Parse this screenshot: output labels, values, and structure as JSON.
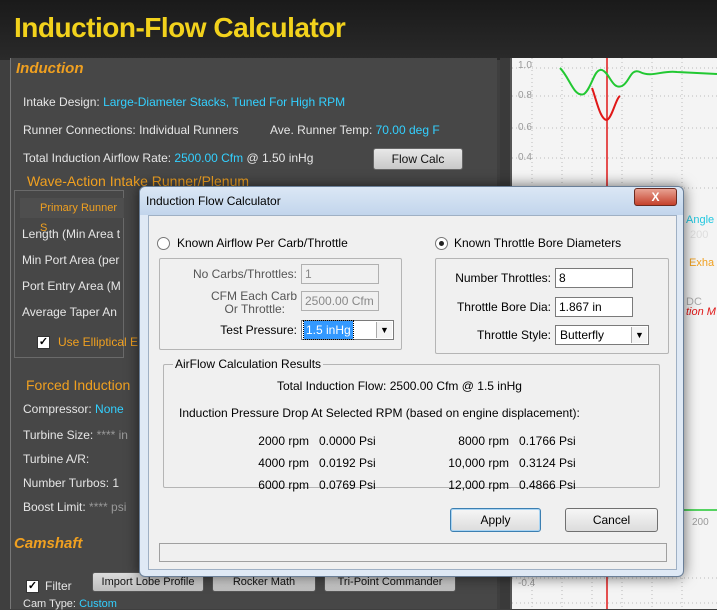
{
  "app": {
    "title": "Induction-Flow Calculator"
  },
  "background": {
    "induction_header": "Induction",
    "intake_design_label": "Intake Design:",
    "intake_design_value": "Large-Diameter Stacks, Tuned For High RPM",
    "runner_connections_label": "Runner Connections:",
    "runner_connections_value": "Individual Runners",
    "runner_temp_label": "Ave. Runner Temp:",
    "runner_temp_value": "70.00 deg F",
    "airflow_rate_label": "Total Induction Airflow Rate:",
    "airflow_rate_value": "2500.00 Cfm",
    "airflow_rate_pressure": "@ 1.50 inHg",
    "flow_calc_button": "Flow Calc",
    "wave_action_header": "Wave-Action Intake Runner/Plenum",
    "primary_runner_tab": "Primary Runner S",
    "runner_fields": [
      "Length (Min Area t",
      "Min Port Area (per",
      "Port Entry Area (M",
      "Average Taper An"
    ],
    "elliptical_label": "Use Elliptical E",
    "forced_induction_header": "Forced Induction",
    "compressor_label": "Compressor:",
    "compressor_value": "None",
    "turbine_size_label": "Turbine Size:",
    "turbine_size_value": "**** in",
    "turbine_ar_label": "Turbine A/R:",
    "number_turbos_label": "Number Turbos:",
    "number_turbos_value": "1",
    "boost_limit_label": "Boost Limit:",
    "boost_limit_value": "**** psi",
    "camshaft_header": "Camshaft",
    "filter_label": "Filter",
    "import_button": "Import Lobe Profile",
    "rocker_button": "Rocker Math",
    "commander_button": "Tri-Point Commander",
    "cam_type_label": "Cam Type:",
    "cam_type_value": "Custom",
    "graph_axis": [
      "1.0",
      "0.8",
      "0.6",
      "0.4",
      "200",
      "-0.4"
    ],
    "graph_side": [
      "Angle",
      "200",
      "Exha",
      "DC",
      "tion M"
    ]
  },
  "dialog": {
    "title": "Induction Flow Calculator",
    "close_label": "X",
    "radio_airflow": "Known Airflow Per Carb/Throttle",
    "radio_bore": "Known Throttle Bore Diameters",
    "no_carbs_label": "No Carbs/Throttles:",
    "no_carbs_value": "1",
    "cfm_each_label_1": "CFM Each Carb",
    "cfm_each_label_2": "Or Throttle:",
    "cfm_each_value": "2500.00 Cfm",
    "test_pressure_label": "Test Pressure:",
    "test_pressure_value": "1.5 inHg",
    "number_throttles_label": "Number Throttles:",
    "number_throttles_value": "8",
    "throttle_bore_label": "Throttle Bore Dia:",
    "throttle_bore_value": "1.867 in",
    "throttle_style_label": "Throttle Style:",
    "throttle_style_value": "Butterfly",
    "results_header": "AirFlow Calculation Results",
    "total_flow_line": "Total Induction Flow:  2500.00 Cfm @ 1.5 inHg",
    "pressure_drop_line": "Induction Pressure Drop At Selected RPM (based on engine displacement):",
    "results": [
      {
        "rpm": "2000 rpm",
        "psi": "0.0000 Psi"
      },
      {
        "rpm": "4000 rpm",
        "psi": "0.0192 Psi"
      },
      {
        "rpm": "6000 rpm",
        "psi": "0.0769 Psi"
      },
      {
        "rpm": "8000 rpm",
        "psi": "0.1766 Psi"
      },
      {
        "rpm": "10,000 rpm",
        "psi": "0.3124 Psi"
      },
      {
        "rpm": "12,000 rpm",
        "psi": "0.4866 Psi"
      }
    ],
    "apply_button": "Apply",
    "cancel_button": "Cancel",
    "status_text": ""
  },
  "colors": {
    "title": "#f2d21c",
    "section_header": "#f0a020",
    "value_text": "#33d0ff",
    "graph_green": "#22c832",
    "graph_red": "#e01818"
  }
}
